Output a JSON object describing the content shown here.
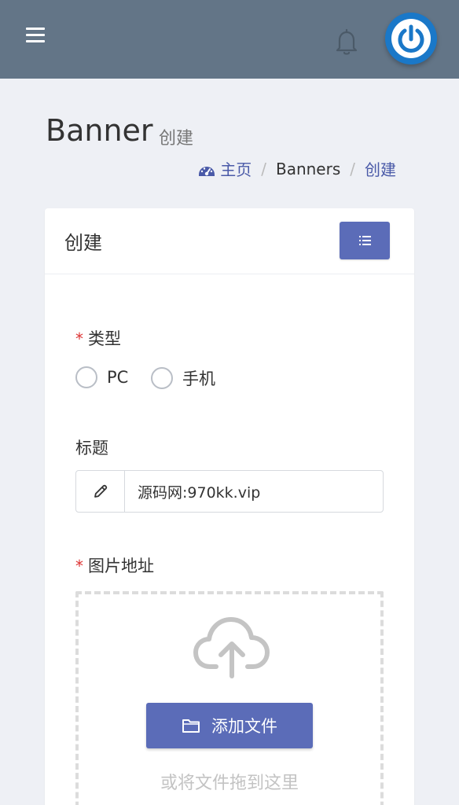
{
  "page": {
    "title": "Banner",
    "subtitle": "创建"
  },
  "breadcrumb": {
    "home": "主页",
    "section": "Banners",
    "current": "创建",
    "separator": "/"
  },
  "navbar": {
    "menu_icon": "hamburger-icon",
    "bell_icon": "bell-icon",
    "avatar_icon": "power-icon"
  },
  "card": {
    "title": "创建",
    "list_button_icon": "list-icon"
  },
  "form": {
    "type": {
      "label": "类型",
      "required_mark": "*",
      "options": [
        "PC",
        "手机"
      ]
    },
    "title": {
      "label": "标题",
      "value": "源码网:970kk.vip",
      "icon": "pencil-icon"
    },
    "image": {
      "label": "图片地址",
      "required_mark": "*",
      "upload_icon": "cloud-upload-icon",
      "add_button": "添加文件",
      "add_button_icon": "folder-icon",
      "drop_hint": "或将文件拖到这里"
    }
  },
  "colors": {
    "navbar": "#637587",
    "primary": "#5b6cb8",
    "avatar": "#1a78c8",
    "required": "#dd3333",
    "background": "#eef0f5"
  }
}
